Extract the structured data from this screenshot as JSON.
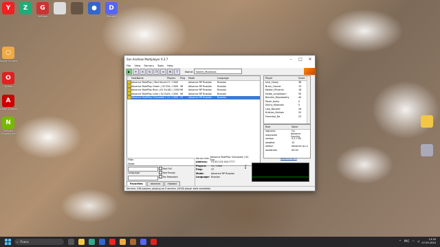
{
  "desktop": {
    "icons": [
      {
        "name": "Yandex Browser",
        "label": "",
        "glyph": "Y",
        "color": "#e22"
      },
      {
        "name": "Zona",
        "label": "",
        "glyph": "Z",
        "color": "#2a7"
      },
      {
        "name": "GeForce",
        "label": "GeForce",
        "glyph": "G",
        "color": "#c33"
      },
      {
        "name": "File",
        "label": "",
        "glyph": "",
        "color": "#ddd"
      },
      {
        "name": "Game",
        "label": "",
        "glyph": "",
        "color": "#654"
      },
      {
        "name": "Controller",
        "label": "",
        "glyph": "●",
        "color": "#36c"
      },
      {
        "name": "Discord",
        "label": "Discord",
        "glyph": "D",
        "color": "#5865f2"
      },
      {
        "name": "Chrome",
        "label": "Google Chrome",
        "glyph": "○",
        "color": "#ea4"
      },
      {
        "name": "Opera",
        "label": "Opera",
        "glyph": "O",
        "color": "#d22"
      },
      {
        "name": "Adobe",
        "label": "Adobe Acrobat",
        "glyph": "A",
        "color": "#c00"
      },
      {
        "name": "Nvidia",
        "label": "GeForce Experience",
        "glyph": "N",
        "color": "#76b900"
      },
      {
        "name": "Folder",
        "label": "",
        "glyph": "",
        "color": "#f2c744"
      },
      {
        "name": "Recycle",
        "label": "",
        "glyph": "",
        "color": "#aab"
      }
    ]
  },
  "window": {
    "title": "San Andreas Multiplayer 0.3.7",
    "menu": [
      "File",
      "View",
      "Servers",
      "Tools",
      "Help"
    ],
    "name_label": "Name:",
    "name_value": "Sweet_Montana",
    "servers": {
      "columns": [
        "",
        "HostName",
        "Players",
        "Ping",
        "Mode",
        "Language"
      ],
      "rows": [
        {
          "host": "Advance RolePlay | Red Server",
          "players": "17 / 1000",
          "ping": "",
          "mode": "Advance RP Russian",
          "lang": "Russian",
          "selected": false
        },
        {
          "host": "Advance RolePlay Green | V2 Exp",
          "players": "34 / 1000",
          "ping": "96",
          "mode": "Advance RP Russian",
          "lang": "Russian",
          "selected": false
        },
        {
          "host": "Advance RolePlay Blue | X2 Exp",
          "players": "162 / 1000",
          "ping": "96",
          "mode": "Advance RP Russian",
          "lang": "Russian",
          "selected": false
        },
        {
          "host": "Advance RolePlay Lime | X2 Exp",
          "players": "24 / 1000",
          "ping": "96",
          "mode": "Advance RP Russian",
          "lang": "Russian",
          "selected": false
        },
        {
          "host": "Advance RolePlay Chocolate | X2 Exp",
          "players": "11 / 1000",
          "ping": "37",
          "mode": "Advance RP Russian",
          "lang": "Russian",
          "selected": true
        }
      ]
    },
    "players": {
      "columns": [
        "Player",
        "Score"
      ],
      "rows": [
        {
          "name": "Julia_Casey",
          "score": "38"
        },
        {
          "name": "Brain_Conner",
          "score": "70"
        },
        {
          "name": "Kaiden_Phoenix",
          "score": "18"
        },
        {
          "name": "Hidde_Lindemann",
          "score": "95"
        },
        {
          "name": "Bendim_Macabrothy",
          "score": "40"
        },
        {
          "name": "Pavel_Avery",
          "score": "0"
        },
        {
          "name": "Sonny_Rosovski",
          "score": "0"
        },
        {
          "name": "Lolo_Bacardi",
          "score": "26"
        },
        {
          "name": "Kristian_Karlsen",
          "score": "52"
        },
        {
          "name": "Ferrerkal_Da",
          "score": "23"
        }
      ]
    },
    "rules": {
      "columns": [
        "Rule",
        "Value"
      ],
      "rows": [
        {
          "rule": "lagcomp",
          "value": "On"
        },
        {
          "rule": "mapname",
          "value": "Advance Country"
        },
        {
          "rule": "version",
          "value": "0.3.7-R2"
        },
        {
          "rule": "weather",
          "value": "15"
        },
        {
          "rule": "weburl",
          "value": "advance-rp.ru"
        },
        {
          "rule": "worldtime",
          "value": "00:00"
        }
      ],
      "link": "advance-rp.ru"
    },
    "filter": {
      "title": "Filter",
      "mode_label": "Mode:",
      "language_label": "Language:",
      "not_full": "Not Full",
      "not_empty": "Not Empty",
      "no_password": "No Password"
    },
    "server_info": {
      "header_label": "Server Info:",
      "header_value": "Advance RolePlay Chocolate | X2 Exp",
      "fields": [
        {
          "k": "Address:",
          "v": "51.83.153.240:7777"
        },
        {
          "k": "Players:",
          "v": "11 / 1000"
        },
        {
          "k": "Ping:",
          "v": "37"
        },
        {
          "k": "Mode:",
          "v": "Advance RP Russian"
        },
        {
          "k": "Language:",
          "v": "Russian"
        }
      ],
      "ping_label": "Ping"
    },
    "tabs": [
      "Favorites",
      "Internet",
      "Hosted"
    ],
    "status": "Servers: 238 players, playing on 5 servers. (5000 player slots available)"
  },
  "taskbar": {
    "search_placeholder": "Поиск",
    "lang": "РУС",
    "time": "13:39",
    "date": "07.09.2024"
  }
}
